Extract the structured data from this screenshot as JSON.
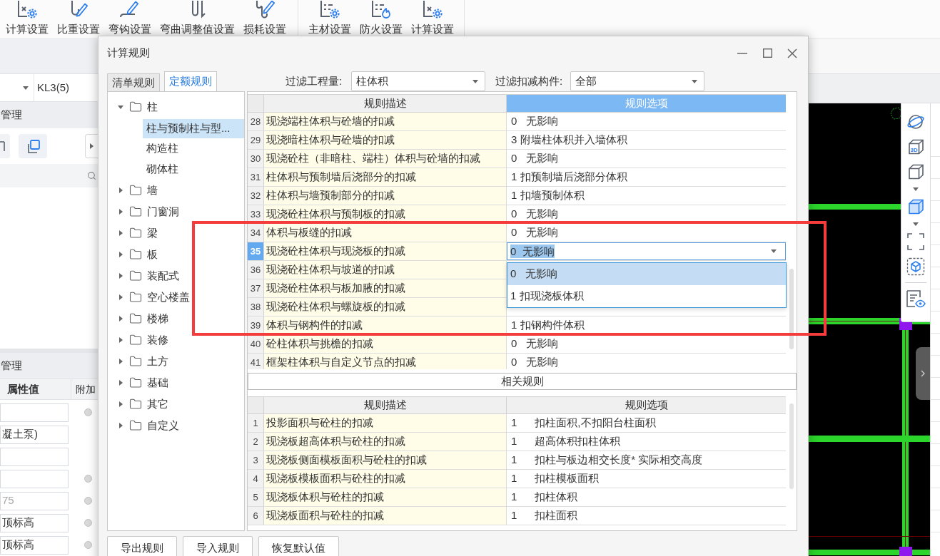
{
  "ribbon": {
    "groups": [
      {
        "buttons": [
          {
            "label": "计算设置"
          },
          {
            "label": "比重设置"
          },
          {
            "label": "弯钩设置"
          },
          {
            "label": "弯曲调整值设置"
          },
          {
            "label": "损耗设置"
          }
        ]
      },
      {
        "buttons": [
          {
            "label": "主材设置"
          },
          {
            "label": "防火设置"
          },
          {
            "label": "计算设置"
          }
        ]
      }
    ]
  },
  "left_panel": {
    "selector": {
      "value": "KL3(5)"
    },
    "section_title": "管理",
    "properties": {
      "title": "管理",
      "columns": [
        "属性值",
        "附加"
      ],
      "rows": [
        {
          "toggle": true
        },
        {
          "value": "凝土泵)",
          "disabled": false,
          "toggle": false
        },
        {
          "toggle": false
        },
        {
          "toggle": true
        },
        {
          "value": "75",
          "disabled": true,
          "toggle": true
        },
        {
          "value": "顶标高",
          "disabled": false,
          "toggle": true
        },
        {
          "value": "顶标高",
          "disabled": false,
          "toggle": true
        }
      ]
    }
  },
  "canvas_toolbar": {
    "cube_label": "3D"
  },
  "dialog": {
    "title": "计算规则",
    "tabs": [
      {
        "label": "清单规则",
        "selected": false
      },
      {
        "label": "定额规则",
        "selected": true
      }
    ],
    "filters": [
      {
        "label": "过滤工程量:",
        "value": "柱体积"
      },
      {
        "label": "过滤扣减构件:",
        "value": "全部"
      }
    ],
    "tree": [
      {
        "label": "柱",
        "expanded": true,
        "selected": false,
        "children": [
          {
            "label": "柱与预制柱与型...",
            "selected": true
          },
          {
            "label": "构造柱",
            "selected": false
          },
          {
            "label": "砌体柱",
            "selected": false
          }
        ]
      },
      {
        "label": "墙",
        "expanded": false,
        "selected": false
      },
      {
        "label": "门窗洞",
        "expanded": false,
        "selected": false
      },
      {
        "label": "梁",
        "expanded": false,
        "selected": false
      },
      {
        "label": "板",
        "expanded": false,
        "selected": false
      },
      {
        "label": "装配式",
        "expanded": false,
        "selected": false
      },
      {
        "label": "空心楼盖",
        "expanded": false,
        "selected": false
      },
      {
        "label": "楼梯",
        "expanded": false,
        "selected": false
      },
      {
        "label": "装修",
        "expanded": false,
        "selected": false
      },
      {
        "label": "土方",
        "expanded": false,
        "selected": false
      },
      {
        "label": "基础",
        "expanded": false,
        "selected": false
      },
      {
        "label": "其它",
        "expanded": false,
        "selected": false
      },
      {
        "label": "自定义",
        "expanded": false,
        "selected": false
      }
    ],
    "rules_table": {
      "columns": [
        {
          "label": "规则描述",
          "selected": false
        },
        {
          "label": "规则选项",
          "selected": true
        }
      ],
      "rows": [
        {
          "index": "28",
          "description": "现浇端柱体积与砼墙的扣减",
          "option": "0   无影响",
          "selected": false
        },
        {
          "index": "29",
          "description": "现浇暗柱体积与砼墙的扣减",
          "option": "3 附墙柱体积并入墙体积",
          "selected": false
        },
        {
          "index": "30",
          "description": "现浇砼柱（非暗柱、端柱）体积与砼墙的扣减",
          "option": "0   无影响",
          "selected": false
        },
        {
          "index": "31",
          "description": "柱体积与预制墙后浇部分的扣减",
          "option": "1 扣预制墙后浇部分体积",
          "selected": false
        },
        {
          "index": "32",
          "description": "柱体积与墙预制部分的扣减",
          "option": "1 扣墙预制体积",
          "selected": false
        },
        {
          "index": "33",
          "description": "现浇砼柱体积与预制板的扣减",
          "option": "0   无影响",
          "selected": false
        },
        {
          "index": "34",
          "description": "体积与板缝的扣减",
          "option": "0   无影响",
          "selected": false
        },
        {
          "index": "35",
          "description": "现浇砼柱体积与现浇板的扣减",
          "option": "0  无影响",
          "selected": true,
          "dropdown": {
            "options": [
              {
                "label": "0   无影响",
                "selected": true
              },
              {
                "label": "1 扣现浇板体积",
                "selected": false
              }
            ]
          }
        },
        {
          "index": "36",
          "description": "现浇砼柱体积与坡道的扣减",
          "selected": false
        },
        {
          "index": "37",
          "description": "现浇砼柱体积与板加腋的扣减",
          "selected": false
        },
        {
          "index": "38",
          "description": "现浇砼柱体积与螺旋板的扣减",
          "selected": false
        },
        {
          "index": "39",
          "description": "体积与钢构件的扣减",
          "option": "1 扣钢构件体积",
          "selected": false
        },
        {
          "index": "40",
          "description": "砼柱体积与挑檐的扣减",
          "option": "0   无影响",
          "selected": false
        },
        {
          "index": "41",
          "description": "框架柱体积与自定义节点的扣减",
          "option": "0   无影响",
          "selected": false
        }
      ]
    },
    "related_rules": {
      "title": "相关规则",
      "columns": [
        "规则描述",
        "规则选项"
      ],
      "rows": [
        {
          "index": "1",
          "description": "投影面积与砼柱的扣减",
          "option": "1      扣柱面积,不扣阳台柱面积"
        },
        {
          "index": "2",
          "description": "现浇板超高体积与砼柱的扣减",
          "option": "1      超高体积扣柱体积"
        },
        {
          "index": "3",
          "description": "现浇板侧面模板面积与砼柱的扣减",
          "option": "1      扣柱与板边相交长度* 实际相交高度"
        },
        {
          "index": "4",
          "description": "现浇板模板面积与砼柱的扣减",
          "option": "1      扣柱模板面积"
        },
        {
          "index": "5",
          "description": "现浇板体积与砼柱的扣减",
          "option": "1      扣柱体积"
        },
        {
          "index": "6",
          "description": "现浇板面积与砼柱的扣减",
          "option": "1      扣柱面积"
        }
      ]
    },
    "buttons": [
      "导出规则",
      "导入规则",
      "恢复默认值"
    ]
  }
}
